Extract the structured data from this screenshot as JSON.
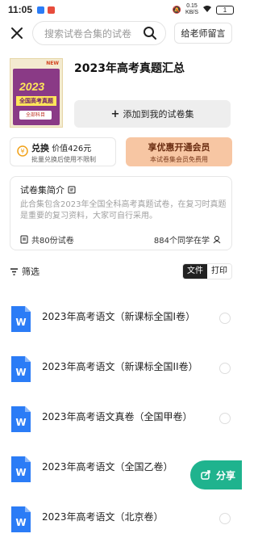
{
  "status_bar": {
    "time": "11:05",
    "net_speed_value": "0.15",
    "net_speed_unit": "KB/S",
    "battery": "1"
  },
  "search": {
    "placeholder": "搜索试卷合集的试卷"
  },
  "header": {
    "teacher_button": "给老师留言"
  },
  "cover": {
    "badge": "NEW",
    "year": "2023",
    "title": "全国高考真题",
    "subtitle": "全部科目"
  },
  "collection": {
    "title": "2023年高考真题汇总",
    "add_button": "添加到我的试卷集"
  },
  "exchange_card": {
    "label": "兑换",
    "price": "价值426元",
    "note": "批量兑换后使用不限制"
  },
  "vip_card": {
    "label": "享优惠开通会员",
    "note": "本试卷集会员免费用"
  },
  "intro": {
    "title": "试卷集简介",
    "text": "此合集包含2023年全国全科高考真题试卷，在复习时真题是重要的复习资料，大家可自行采用。",
    "count": "共80份试卷",
    "learning": "884个同学在学"
  },
  "filter": {
    "label": "筛选",
    "tab_file": "文件",
    "tab_print": "打印"
  },
  "documents": [
    {
      "title": "2023年高考语文（新课标全国I卷）"
    },
    {
      "title": "2023年高考语文（新课标全国II卷）"
    },
    {
      "title": "2023年高考语文真卷（全国甲卷）"
    },
    {
      "title": "2023年高考语文（全国乙卷）"
    },
    {
      "title": "2023年高考语文（北京卷）"
    }
  ],
  "share": {
    "label": "分享"
  },
  "colors": {
    "accent_green": "#1fb38e",
    "doc_blue": "#2b7cf6",
    "vip_bg": "#f7c6a3"
  },
  "icons": [
    "close-icon",
    "search-icon",
    "plus-icon",
    "coin-icon",
    "note-icon",
    "files-icon",
    "users-icon",
    "filter-icon",
    "word-doc-icon",
    "share-icon"
  ]
}
